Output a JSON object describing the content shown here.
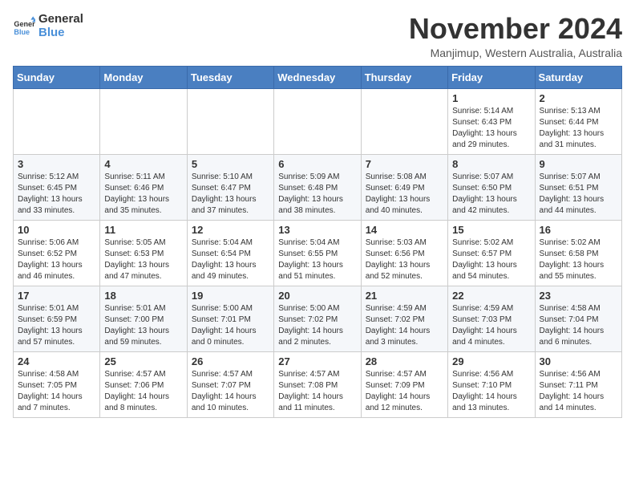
{
  "header": {
    "logo_line1": "General",
    "logo_line2": "Blue",
    "month_title": "November 2024",
    "location": "Manjimup, Western Australia, Australia"
  },
  "weekdays": [
    "Sunday",
    "Monday",
    "Tuesday",
    "Wednesday",
    "Thursday",
    "Friday",
    "Saturday"
  ],
  "weeks": [
    [
      {
        "day": "",
        "info": ""
      },
      {
        "day": "",
        "info": ""
      },
      {
        "day": "",
        "info": ""
      },
      {
        "day": "",
        "info": ""
      },
      {
        "day": "",
        "info": ""
      },
      {
        "day": "1",
        "info": "Sunrise: 5:14 AM\nSunset: 6:43 PM\nDaylight: 13 hours\nand 29 minutes."
      },
      {
        "day": "2",
        "info": "Sunrise: 5:13 AM\nSunset: 6:44 PM\nDaylight: 13 hours\nand 31 minutes."
      }
    ],
    [
      {
        "day": "3",
        "info": "Sunrise: 5:12 AM\nSunset: 6:45 PM\nDaylight: 13 hours\nand 33 minutes."
      },
      {
        "day": "4",
        "info": "Sunrise: 5:11 AM\nSunset: 6:46 PM\nDaylight: 13 hours\nand 35 minutes."
      },
      {
        "day": "5",
        "info": "Sunrise: 5:10 AM\nSunset: 6:47 PM\nDaylight: 13 hours\nand 37 minutes."
      },
      {
        "day": "6",
        "info": "Sunrise: 5:09 AM\nSunset: 6:48 PM\nDaylight: 13 hours\nand 38 minutes."
      },
      {
        "day": "7",
        "info": "Sunrise: 5:08 AM\nSunset: 6:49 PM\nDaylight: 13 hours\nand 40 minutes."
      },
      {
        "day": "8",
        "info": "Sunrise: 5:07 AM\nSunset: 6:50 PM\nDaylight: 13 hours\nand 42 minutes."
      },
      {
        "day": "9",
        "info": "Sunrise: 5:07 AM\nSunset: 6:51 PM\nDaylight: 13 hours\nand 44 minutes."
      }
    ],
    [
      {
        "day": "10",
        "info": "Sunrise: 5:06 AM\nSunset: 6:52 PM\nDaylight: 13 hours\nand 46 minutes."
      },
      {
        "day": "11",
        "info": "Sunrise: 5:05 AM\nSunset: 6:53 PM\nDaylight: 13 hours\nand 47 minutes."
      },
      {
        "day": "12",
        "info": "Sunrise: 5:04 AM\nSunset: 6:54 PM\nDaylight: 13 hours\nand 49 minutes."
      },
      {
        "day": "13",
        "info": "Sunrise: 5:04 AM\nSunset: 6:55 PM\nDaylight: 13 hours\nand 51 minutes."
      },
      {
        "day": "14",
        "info": "Sunrise: 5:03 AM\nSunset: 6:56 PM\nDaylight: 13 hours\nand 52 minutes."
      },
      {
        "day": "15",
        "info": "Sunrise: 5:02 AM\nSunset: 6:57 PM\nDaylight: 13 hours\nand 54 minutes."
      },
      {
        "day": "16",
        "info": "Sunrise: 5:02 AM\nSunset: 6:58 PM\nDaylight: 13 hours\nand 55 minutes."
      }
    ],
    [
      {
        "day": "17",
        "info": "Sunrise: 5:01 AM\nSunset: 6:59 PM\nDaylight: 13 hours\nand 57 minutes."
      },
      {
        "day": "18",
        "info": "Sunrise: 5:01 AM\nSunset: 7:00 PM\nDaylight: 13 hours\nand 59 minutes."
      },
      {
        "day": "19",
        "info": "Sunrise: 5:00 AM\nSunset: 7:01 PM\nDaylight: 14 hours\nand 0 minutes."
      },
      {
        "day": "20",
        "info": "Sunrise: 5:00 AM\nSunset: 7:02 PM\nDaylight: 14 hours\nand 2 minutes."
      },
      {
        "day": "21",
        "info": "Sunrise: 4:59 AM\nSunset: 7:02 PM\nDaylight: 14 hours\nand 3 minutes."
      },
      {
        "day": "22",
        "info": "Sunrise: 4:59 AM\nSunset: 7:03 PM\nDaylight: 14 hours\nand 4 minutes."
      },
      {
        "day": "23",
        "info": "Sunrise: 4:58 AM\nSunset: 7:04 PM\nDaylight: 14 hours\nand 6 minutes."
      }
    ],
    [
      {
        "day": "24",
        "info": "Sunrise: 4:58 AM\nSunset: 7:05 PM\nDaylight: 14 hours\nand 7 minutes."
      },
      {
        "day": "25",
        "info": "Sunrise: 4:57 AM\nSunset: 7:06 PM\nDaylight: 14 hours\nand 8 minutes."
      },
      {
        "day": "26",
        "info": "Sunrise: 4:57 AM\nSunset: 7:07 PM\nDaylight: 14 hours\nand 10 minutes."
      },
      {
        "day": "27",
        "info": "Sunrise: 4:57 AM\nSunset: 7:08 PM\nDaylight: 14 hours\nand 11 minutes."
      },
      {
        "day": "28",
        "info": "Sunrise: 4:57 AM\nSunset: 7:09 PM\nDaylight: 14 hours\nand 12 minutes."
      },
      {
        "day": "29",
        "info": "Sunrise: 4:56 AM\nSunset: 7:10 PM\nDaylight: 14 hours\nand 13 minutes."
      },
      {
        "day": "30",
        "info": "Sunrise: 4:56 AM\nSunset: 7:11 PM\nDaylight: 14 hours\nand 14 minutes."
      }
    ]
  ]
}
